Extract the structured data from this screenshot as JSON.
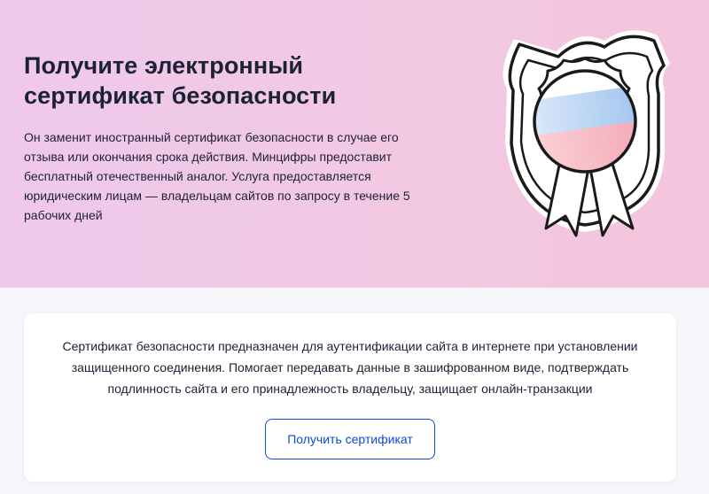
{
  "hero": {
    "title": "Получите электронный сертификат безопасности",
    "description": "Он заменит иностранный сертификат безопасности в случае его отзыва или окончания срока действия. Минцифры предоставит бесплатный отечественный аналог. Услуга предоставляется юридическим лицам — владельцам сайтов по запросу в течение 5 рабочих дней",
    "illustration_icon": "certificate-badge-icon"
  },
  "info_card": {
    "text": "Сертификат безопасности предназначен для аутентификации сайта в интернете при установлении защищенного соединения. Помогает передавать данные в зашифрованном виде, подтверждать подлинность сайта и его принадлежность владельцу, защищает онлайн-транзакции",
    "button_label": "Получить сертификат"
  },
  "colors": {
    "hero_bg_start": "#efc8ec",
    "hero_bg_end": "#f4c5dd",
    "text": "#1c2134",
    "accent": "#0d4cd3",
    "page_bg": "#f5f6fa",
    "card_bg": "#ffffff",
    "flag_white": "#ffffff",
    "flag_blue": "#9fc4ef",
    "flag_red": "#f3a9b4"
  }
}
